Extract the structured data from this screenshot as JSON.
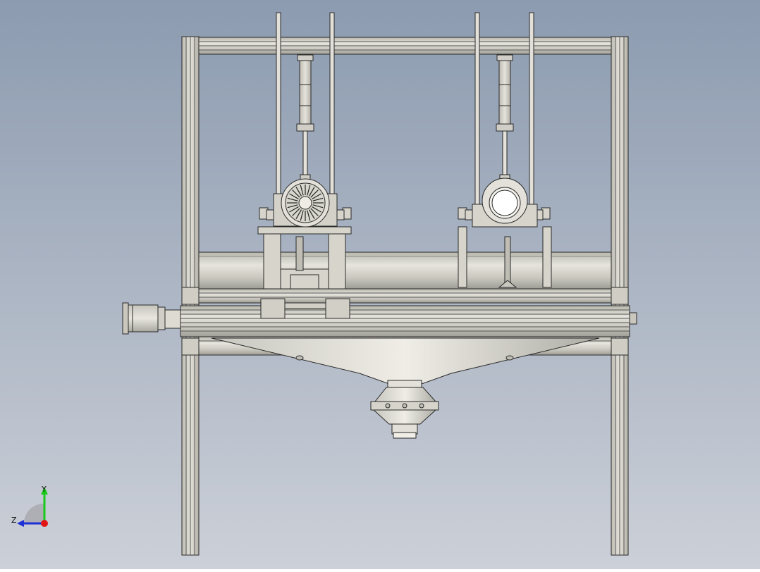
{
  "viewport": {
    "background_top": "#8c9bb0",
    "background_bottom": "#ccd0d8",
    "part_fill": "#d8d6cc",
    "part_stroke": "#2a2a2a"
  },
  "triad": {
    "y_label": "Y",
    "z_label": "Z",
    "y_color": "#19c919",
    "z_color": "#1d2fd6",
    "x_color": "#e01515"
  }
}
